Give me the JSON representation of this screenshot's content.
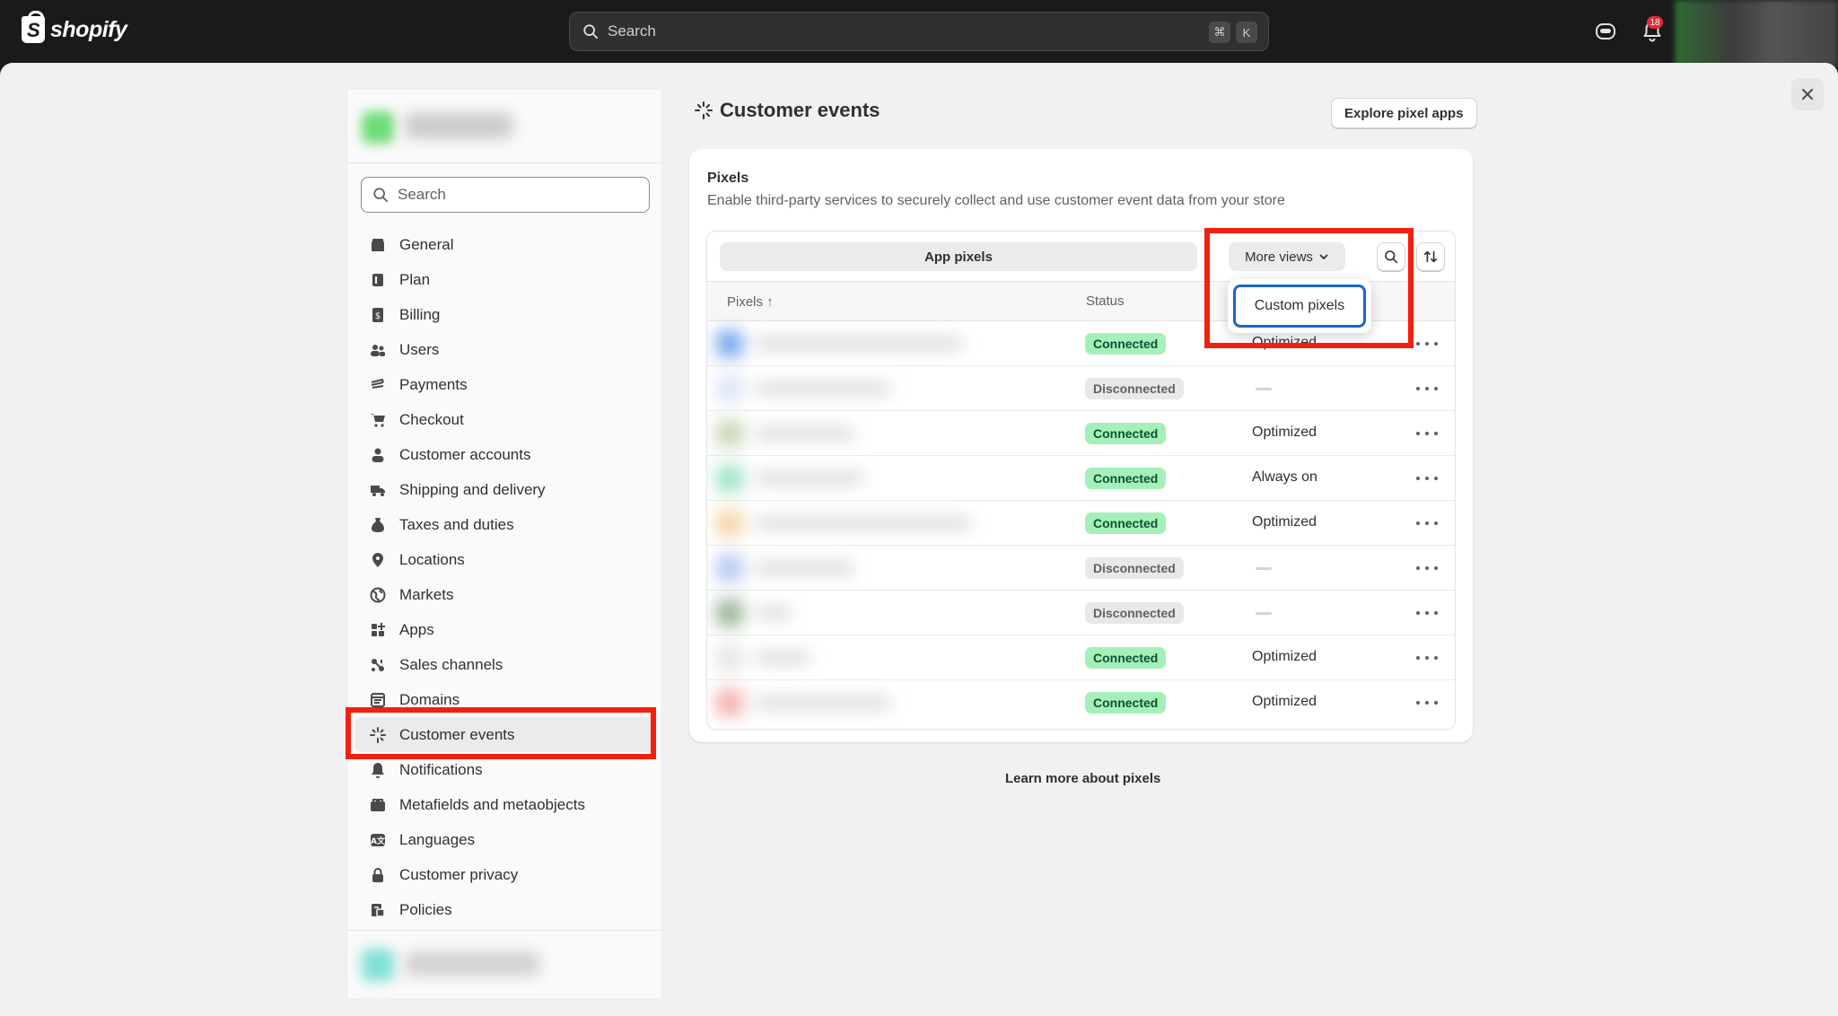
{
  "topbar": {
    "brand": "shopify",
    "search_placeholder": "Search",
    "shortcut_cmd": "⌘",
    "shortcut_key": "K",
    "notification_count": "18"
  },
  "sidebar": {
    "search_placeholder": "Search",
    "items": [
      {
        "label": "General",
        "icon": "store-icon"
      },
      {
        "label": "Plan",
        "icon": "plan-icon"
      },
      {
        "label": "Billing",
        "icon": "billing-icon"
      },
      {
        "label": "Users",
        "icon": "users-icon"
      },
      {
        "label": "Payments",
        "icon": "payments-icon"
      },
      {
        "label": "Checkout",
        "icon": "cart-icon"
      },
      {
        "label": "Customer accounts",
        "icon": "person-icon"
      },
      {
        "label": "Shipping and delivery",
        "icon": "truck-icon"
      },
      {
        "label": "Taxes and duties",
        "icon": "tax-icon"
      },
      {
        "label": "Locations",
        "icon": "location-icon"
      },
      {
        "label": "Markets",
        "icon": "globe-icon"
      },
      {
        "label": "Apps",
        "icon": "apps-icon"
      },
      {
        "label": "Sales channels",
        "icon": "channels-icon"
      },
      {
        "label": "Domains",
        "icon": "domain-icon"
      },
      {
        "label": "Customer events",
        "icon": "sparkle-icon",
        "active": true
      },
      {
        "label": "Notifications",
        "icon": "bell-icon"
      },
      {
        "label": "Metafields and metaobjects",
        "icon": "metafields-icon"
      },
      {
        "label": "Languages",
        "icon": "language-icon"
      },
      {
        "label": "Customer privacy",
        "icon": "lock-icon"
      },
      {
        "label": "Policies",
        "icon": "policy-icon"
      }
    ]
  },
  "main": {
    "title": "Customer events",
    "explore_button": "Explore pixel apps",
    "card": {
      "title": "Pixels",
      "description": "Enable third-party services to securely collect and use customer event data from your store",
      "tab_app_pixels": "App pixels",
      "tab_more_views": "More views",
      "col_pixels": "Pixels",
      "col_pixels_sort": "↑",
      "col_status": "Status",
      "rows": [
        {
          "status": "Connected",
          "mode": "Optimized",
          "icon_color": "#7aa7f0"
        },
        {
          "status": "Disconnected",
          "mode": "",
          "icon_color": "#dde6f7"
        },
        {
          "status": "Connected",
          "mode": "Optimized",
          "icon_color": "#c9d6b8"
        },
        {
          "status": "Connected",
          "mode": "Always on",
          "icon_color": "#9fe3c6"
        },
        {
          "status": "Connected",
          "mode": "Optimized",
          "icon_color": "#f7d5a8"
        },
        {
          "status": "Disconnected",
          "mode": "",
          "icon_color": "#b7c9f0"
        },
        {
          "status": "Disconnected",
          "mode": "",
          "icon_color": "#9bb59a"
        },
        {
          "status": "Connected",
          "mode": "Optimized",
          "icon_color": "#e6e6e6"
        },
        {
          "status": "Connected",
          "mode": "Optimized",
          "icon_color": "#f3b0b0"
        }
      ],
      "popover_item": "Custom pixels"
    },
    "learn_more": "Learn more about pixels"
  },
  "colors": {
    "highlight": "#f4200e",
    "connected_bg": "#a5f0b8",
    "focus": "#1b68c7"
  }
}
